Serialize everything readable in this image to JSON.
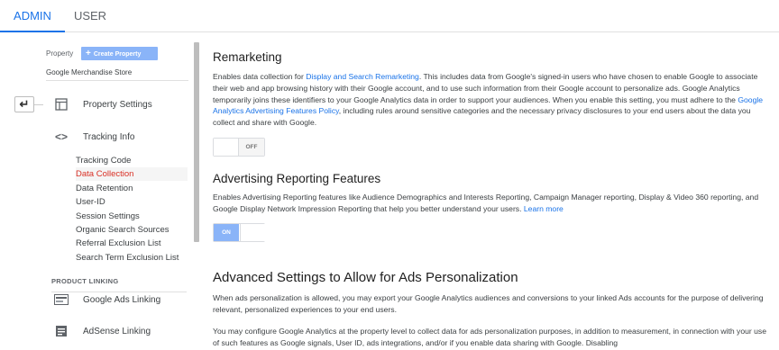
{
  "tabs": {
    "admin": "ADMIN",
    "user": "USER"
  },
  "leftnav": {
    "property_label": "Property",
    "create_property": "Create Property",
    "store_name": "Google Merchandise Store",
    "items": [
      {
        "label": "Property Settings",
        "icon": "property-settings-icon"
      },
      {
        "label": "Tracking Info",
        "icon": "code-brackets-icon"
      }
    ],
    "tracking_sub": [
      "Tracking Code",
      "Data Collection",
      "Data Retention",
      "User-ID",
      "Session Settings",
      "Organic Search Sources",
      "Referral Exclusion List",
      "Search Term Exclusion List"
    ],
    "active_sub": "Data Collection",
    "product_linking_header": "PRODUCT LINKING",
    "product_items": [
      {
        "label": "Google Ads Linking",
        "icon": "google-ads-icon"
      },
      {
        "label": "AdSense Linking",
        "icon": "adsense-icon"
      }
    ]
  },
  "main": {
    "remarketing": {
      "title": "Remarketing",
      "p1_a": "Enables data collection for ",
      "p1_link": "Display and Search Remarketing",
      "p1_b": ". This includes data from Google's signed-in users who have chosen to enable Google to associate their web and app browsing history with their Google account, and to use such information from their Google account to personalize ads. Google Analytics temporarily joins these identifiers to your Google Analytics data in order to support your audiences. When you enable this setting, you must adhere to the ",
      "p1_link2": "Google Analytics Advertising Features Policy",
      "p1_c": ", including rules around sensitive categories and the necessary privacy disclosures to your end users about the data you collect and share with Google.",
      "toggle": "OFF"
    },
    "adv_reporting": {
      "title": "Advertising Reporting Features",
      "p_a": "Enables Advertising Reporting features like Audience Demographics and Interests Reporting, Campaign Manager reporting, Display & Video 360 reporting, and Google Display Network Impression Reporting that help you better understand your users. ",
      "p_link": "Learn more",
      "toggle": "ON"
    },
    "advanced": {
      "title": "Advanced Settings to Allow for Ads Personalization",
      "p1": "When ads personalization is allowed, you may export your Google Analytics audiences and conversions to your linked Ads accounts for the purpose of delivering relevant, personalized experiences to your end users.",
      "p2": "You may configure Google Analytics at the property level to collect data for ads personalization purposes, in addition to measurement, in connection with your use of such features as Google signals, User ID, ads integrations, and/or if you enable data sharing with Google. Disabling"
    }
  }
}
